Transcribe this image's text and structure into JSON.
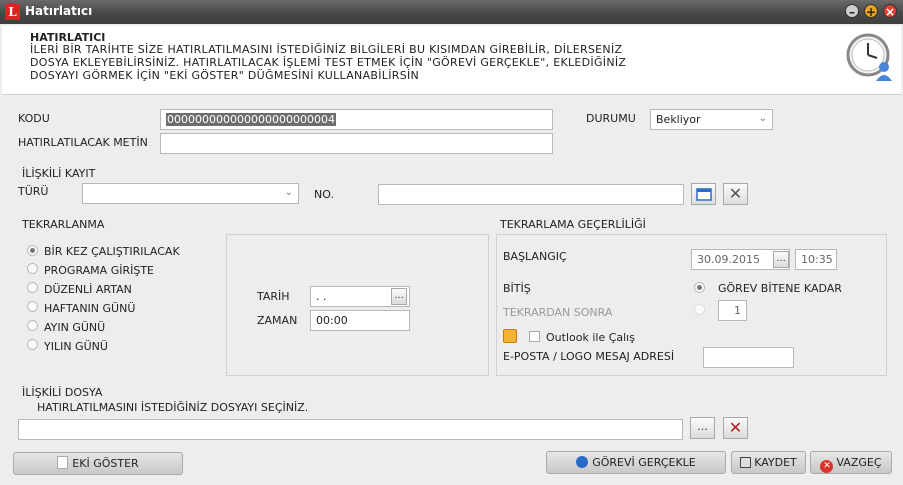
{
  "window": {
    "title": "Hatırlatıcı",
    "logo_letter": "L"
  },
  "header": {
    "title": "HATIRLATICI",
    "lines": [
      "İLERİ BİR TARİHTE SİZE HATIRLATILMASINI İSTEDİĞİNİZ BİLGİLERİ BU KISIMDAN GİREBİLİR, DİLERSENİZ",
      "DOSYA EKLEYEBİLİRSİNİZ. HATIRLATILACAK İŞLEMİ TEST ETMEK İÇİN \"GÖREVİ GERÇEKLE\", EKLEDİĞİNİZ",
      "DOSYAYI GÖRMEK İÇİN \"EKİ GÖSTER\" DÜĞMESİNİ KULLANABİLİRSİN"
    ]
  },
  "form": {
    "kodu_label": "KODU",
    "kodu_value": "000000000000000000000004",
    "metin_label": "HATIRLATILACAK METİN",
    "metin_value": "",
    "durumu_label": "DURUMU",
    "durumu_value": "Bekliyor"
  },
  "iliskili_kayit": {
    "title": "İLİŞKİLİ KAYIT",
    "turu_label": "TÜRÜ",
    "turu_value": "",
    "no_label": "NO.",
    "no_value": ""
  },
  "tekrarlanma": {
    "title": "TEKRARLANMA",
    "options": [
      {
        "label": "BİR KEZ ÇALIŞTIRILACAK",
        "selected": true
      },
      {
        "label": "PROGRAMA GİRİŞTE",
        "selected": false
      },
      {
        "label": "DÜZENLİ ARTAN",
        "selected": false
      },
      {
        "label": "HAFTANIN GÜNÜ",
        "selected": false
      },
      {
        "label": "AYIN GÜNÜ",
        "selected": false
      },
      {
        "label": "YILIN GÜNÜ",
        "selected": false
      }
    ],
    "tarih_label": "TARİH",
    "tarih_value": ". .",
    "zaman_label": "ZAMAN",
    "zaman_value": "00:00"
  },
  "gecerlilik": {
    "title": "TEKRARLAMA GEÇERLİLİĞİ",
    "baslangic_label": "BAŞLANGIÇ",
    "baslangic_date": "30.09.2015",
    "baslangic_time": "10:35",
    "bitis_label": "BİTİŞ",
    "bitis_option": "GÖREV BİTENE KADAR",
    "tekrardan_label": "TEKRARDAN SONRA",
    "tekrardan_value": "1",
    "outlook_label": "Outlook ile Çalış",
    "eposta_label": "E-POSTA / LOGO MESAJ ADRESİ",
    "eposta_value": ""
  },
  "iliskili_dosya": {
    "title": "İLİŞKİLİ DOSYA",
    "hint": "HATIRLATILMASINI İSTEDİĞİNİZ DOSYAYI SEÇİNİZ.",
    "value": ""
  },
  "buttons": {
    "ellipsis": "...",
    "eki_goster": "EKİ GÖSTER",
    "gorevi_gercekle": "GÖREVİ GERÇEKLE",
    "kaydet": "KAYDET",
    "vazgec": "VAZGEÇ"
  },
  "colors": {
    "titlebar": "#4a4a4a",
    "header_bg": "#ffffff",
    "body_bg": "#ededed",
    "cancel_red": "#d9342b",
    "blue_icon": "#2a6bc9"
  }
}
